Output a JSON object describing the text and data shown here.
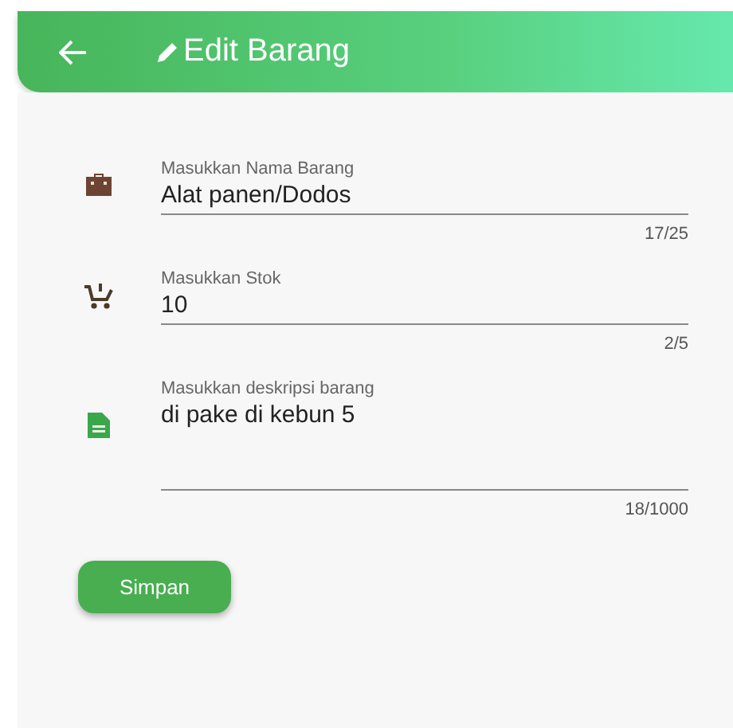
{
  "app_bar": {
    "title": "Edit Barang"
  },
  "fields": [
    {
      "label": "Masukkan Nama Barang",
      "value": "Alat panen/Dodos",
      "counter": "17/25",
      "multiline": false
    },
    {
      "label": "Masukkan Stok",
      "value": "10",
      "counter": "2/5",
      "multiline": false
    },
    {
      "label": "Masukkan deskripsi barang",
      "value": "di pake di kebun 5",
      "counter": "18/1000",
      "multiline": true
    }
  ],
  "save_button": {
    "label": "Simpan"
  }
}
